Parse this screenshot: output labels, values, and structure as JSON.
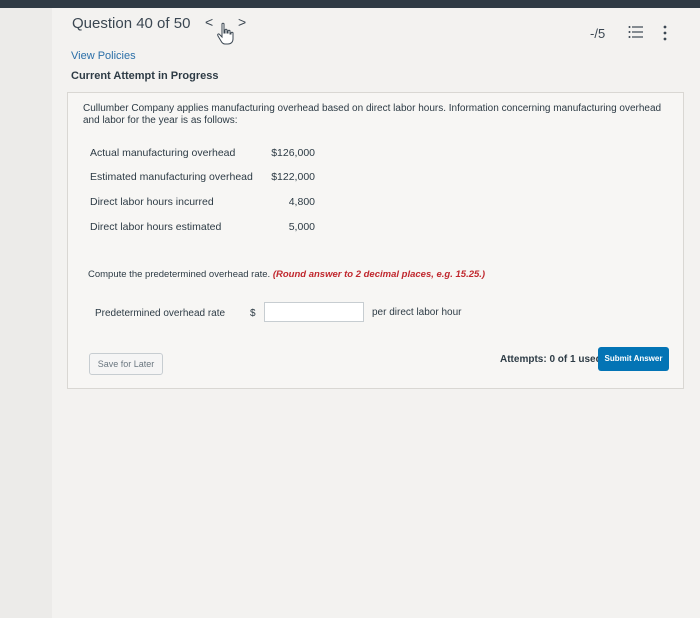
{
  "header": {
    "question_title": "Question 40 of 50",
    "prev_glyph": "<",
    "next_glyph": ">",
    "score": "-/5",
    "icons": [
      "cursor-hand-icon",
      "list-icon",
      "kebab-menu-icon"
    ]
  },
  "meta": {
    "view_policies": "View Policies",
    "attempt_status": "Current Attempt in Progress"
  },
  "question": {
    "prompt": "Cullumber Company applies manufacturing overhead based on direct labor hours. Information concerning manufacturing overhead and labor for the year is as follows:",
    "rows": [
      {
        "label": "Actual manufacturing overhead",
        "value": "$126,000"
      },
      {
        "label": "Estimated manufacturing overhead",
        "value": "$122,000"
      },
      {
        "label": "Direct labor hours incurred",
        "value": "4,800"
      },
      {
        "label": "Direct labor hours estimated",
        "value": "5,000"
      }
    ],
    "instruction": "Compute the predetermined overhead rate.",
    "hint": "(Round answer to 2 decimal places, e.g. 15.25.)"
  },
  "answer": {
    "label": "Predetermined overhead rate",
    "currency": "$",
    "value": "",
    "unit": "per direct labor hour"
  },
  "footer": {
    "save_label": "Save for Later",
    "attempts": "Attempts: 0 of 1 used",
    "submit_label": "Submit Answer"
  },
  "colors": {
    "accent": "#0374b5",
    "link": "#2b6fa8",
    "hint": "#c0272d"
  }
}
